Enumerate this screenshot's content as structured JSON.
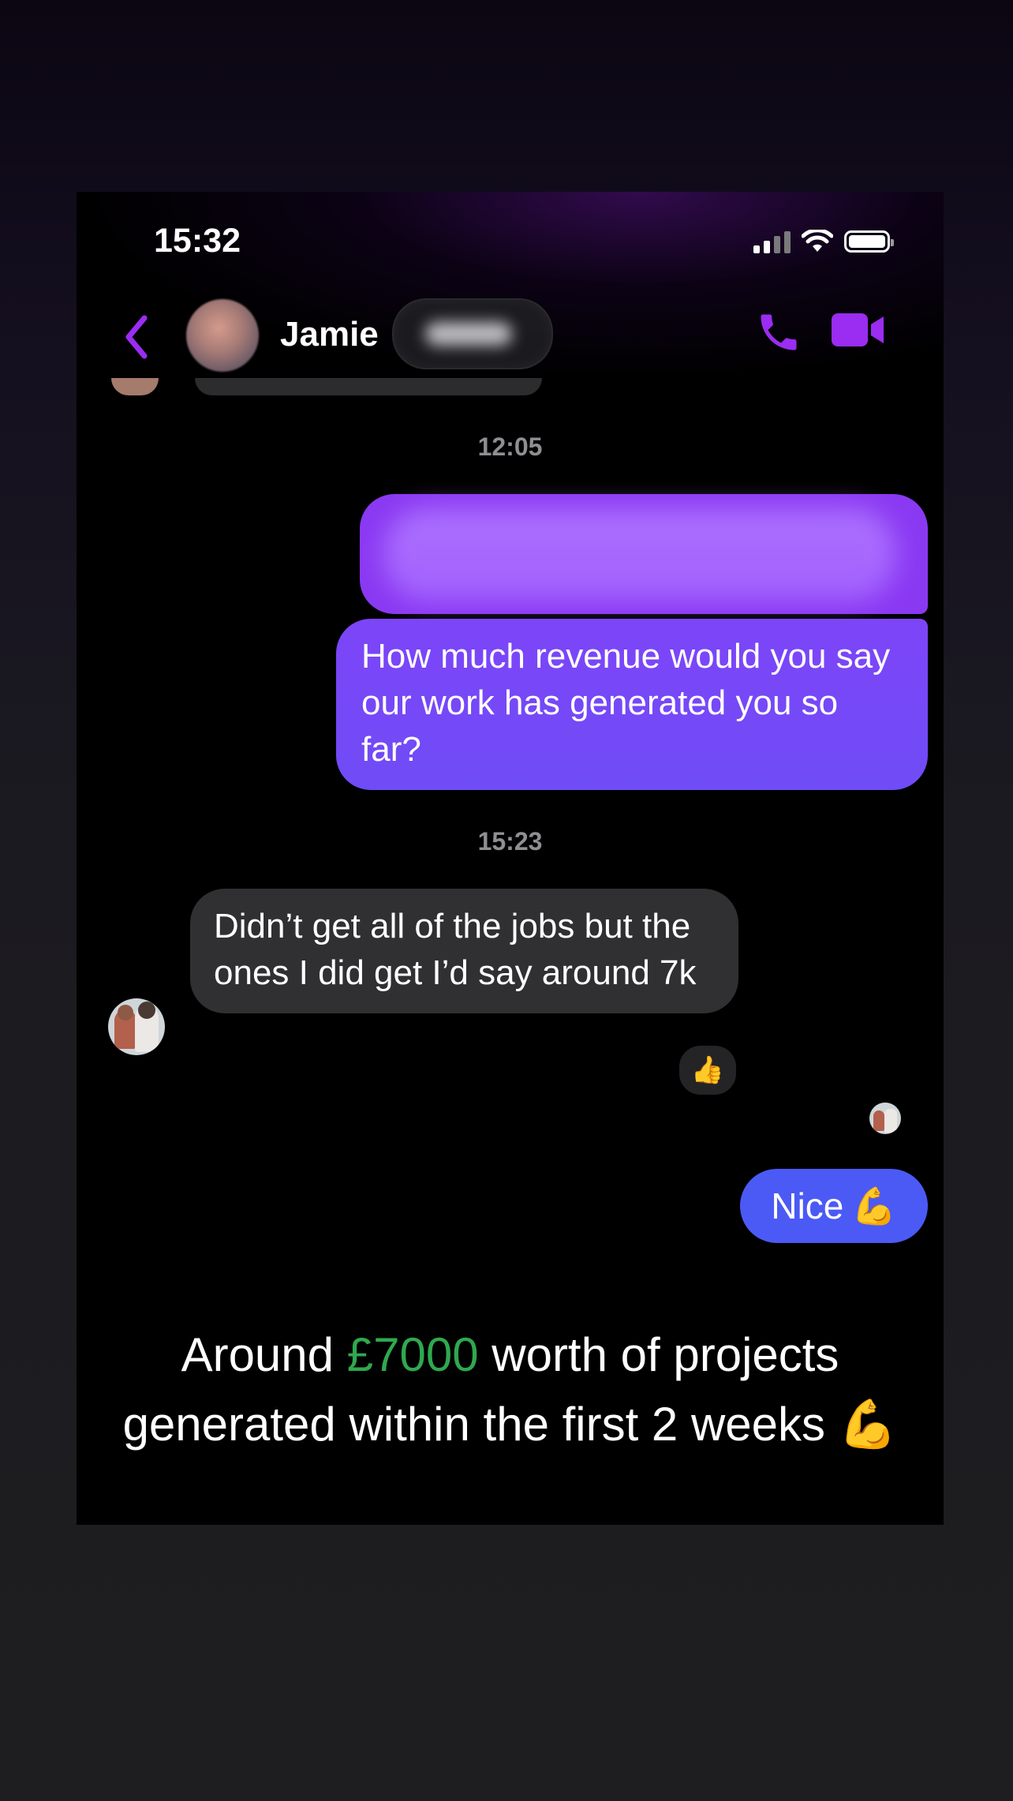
{
  "status_bar": {
    "time": "15:32"
  },
  "header": {
    "contact_name": "Jamie"
  },
  "conversation": {
    "timestamps": [
      "12:05",
      "15:23"
    ],
    "outgoing_message": "How much revenue would you say our work has generated you so far?",
    "incoming_message": "Didn’t get all of the jobs but the ones I did get I’d say around 7k",
    "reaction": "👍",
    "reply_text": "Nice",
    "reply_emoji": "💪"
  },
  "caption": {
    "prefix": "Around",
    "amount": "£7000",
    "suffix": "worth of projects generated within the first 2 weeks",
    "emoji": "💪"
  },
  "colors": {
    "accent_purple": "#7d45f8",
    "reply_blue": "#4b5af5",
    "amount_green": "#2fa84f"
  }
}
